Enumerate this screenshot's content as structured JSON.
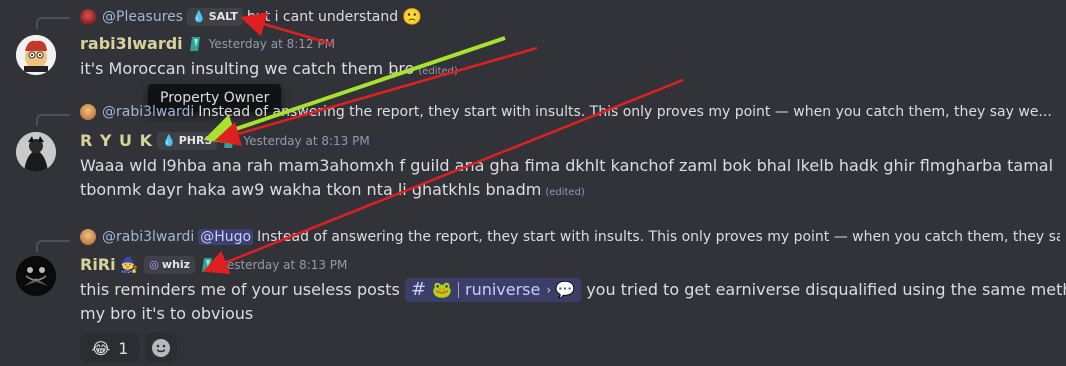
{
  "messages": [
    {
      "reply": {
        "username": "@Pleasures",
        "tag": "SALT",
        "text": "but i cant understand",
        "emoji": "🙁"
      },
      "username": "rabi3lwardi",
      "username_color": "#d7d39a",
      "timestamp": "Yesterday at 8:12 PM",
      "content": "it's Moroccan insulting we catch them bro",
      "edited": "(edited)"
    },
    {
      "reply": {
        "username": "@rabi3lwardi",
        "text": "Instead of answering the report, they start with insults. This only proves my point — when you catch them, they say we..."
      },
      "username": "R Y U K",
      "username_color": "#d7d39a",
      "tag": "PHRS",
      "timestamp": "Yesterday at 8:13 PM",
      "content_line1": "Waaa wld l9hba ana rah mam3ahomxh f guild ana gha fima dkhlt kanchof zaml bok bhal lkelb hadk ghir flmgharba tamal",
      "content_line2": "tbonmk dayr haka aw9 wakha tkon nta li ghatkhls bnadm",
      "edited": "(edited)"
    },
    {
      "reply": {
        "username": "@rabi3lwardi",
        "mention": "@Hugo",
        "text": "Instead of answering the report, they start with insults. This only proves my point — when you catch them, they say we..."
      },
      "username": "RiRi",
      "username_color": "#d7d39a",
      "tag": "whiz",
      "timestamp": "Yesterday at 8:13 PM",
      "content_before": "this reminders me of your useless posts",
      "channel": {
        "hash": "#",
        "name": "runiverse",
        "chevron": "›"
      },
      "content_after": "you tried to get earniverse disqualified using the same method",
      "content_line2": "my bro it's to obvious",
      "reactions": [
        {
          "emoji": "😂",
          "count": "1"
        }
      ]
    }
  ],
  "tooltip": {
    "text": "Property Owner"
  },
  "annotations": {
    "arrow_color": "#e02020",
    "highlight_arrow_color": "#a6e22e"
  }
}
